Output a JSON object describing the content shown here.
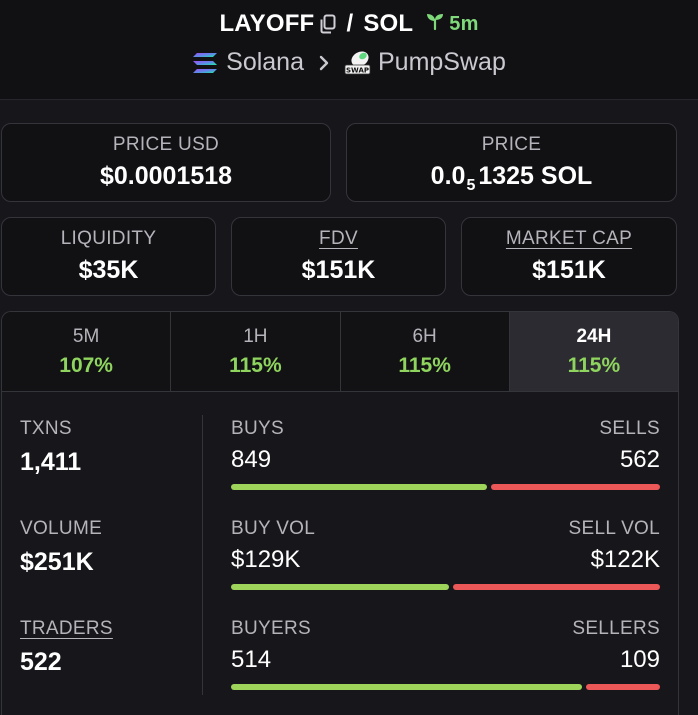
{
  "header": {
    "token": "LAYOFF",
    "separator": "/",
    "quote": "SOL",
    "age": "5m",
    "chain": "Solana",
    "dex": "PumpSwap",
    "dex_logo_text": "SWAP",
    "icons": {
      "copy": "copy-icon",
      "age": "sprout-icon",
      "chain": "solana-logo-icon",
      "chevron": "chevron-right-icon",
      "dex": "pumpswap-logo-icon"
    }
  },
  "price_usd": {
    "label": "PRICE USD",
    "value": "$0.0001518"
  },
  "price_native": {
    "label": "PRICE",
    "prefix": "0.0",
    "subscript": "5",
    "digits": "1325",
    "unit": "SOL"
  },
  "liquidity": {
    "label": "LIQUIDITY",
    "value": "$35K"
  },
  "fdv": {
    "label": "FDV",
    "value": "$151K"
  },
  "market_cap": {
    "label": "MARKET CAP",
    "value": "$151K"
  },
  "tabs": [
    {
      "label": "5M",
      "value": "107%"
    },
    {
      "label": "1H",
      "value": "115%"
    },
    {
      "label": "6H",
      "value": "115%"
    },
    {
      "label": "24H",
      "value": "115%",
      "active": true
    }
  ],
  "stats": {
    "txns": {
      "label": "TXNS",
      "value": "1,411"
    },
    "volume": {
      "label": "VOLUME",
      "value": "$251K"
    },
    "traders": {
      "label": "TRADERS",
      "value": "522"
    }
  },
  "splits": {
    "buys": {
      "left_label": "BUYS",
      "right_label": "SELLS",
      "left_value": "849",
      "right_value": "562",
      "left_fraction": 0.602
    },
    "volume": {
      "left_label": "BUY VOL",
      "right_label": "SELL VOL",
      "left_value": "$129K",
      "right_value": "$122K",
      "left_fraction": 0.514
    },
    "makers": {
      "left_label": "BUYERS",
      "right_label": "SELLERS",
      "left_value": "514",
      "right_value": "109",
      "left_fraction": 0.825
    }
  },
  "colors": {
    "positive": "#8fd45e",
    "buy_bar": "#9ed45a",
    "sell_bar": "#ec5757",
    "background": "#17171b"
  }
}
